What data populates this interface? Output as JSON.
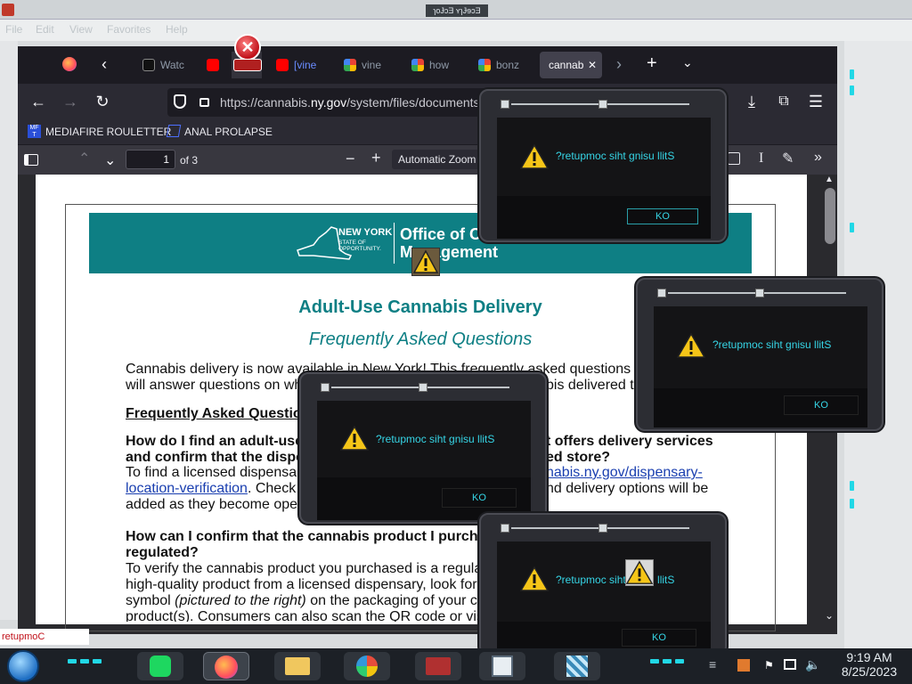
{
  "os": {
    "top_strip_title": "ɿoɈɔƎ ʏɿɈɘɔƎ",
    "menu": [
      "File",
      "Edit",
      "View",
      "Favorites",
      "Help"
    ],
    "desktop_badge": "retupmoC",
    "clock": {
      "time": "9:19 AM",
      "date": "8/25/2023"
    }
  },
  "browser": {
    "tabs": [
      {
        "label": "Watc",
        "icon": "video-site-icon"
      },
      {
        "label": "",
        "icon": "youtube-icon"
      },
      {
        "label": "",
        "icon": "youtube-icon"
      },
      {
        "label": "[vine",
        "icon": "youtube-icon"
      },
      {
        "label": "vine",
        "icon": "google-icon"
      },
      {
        "label": "how",
        "icon": "google-icon"
      },
      {
        "label": "bonz",
        "icon": "google-icon"
      },
      {
        "label": "cannab",
        "icon": "pdf-icon",
        "active": true
      }
    ],
    "url": {
      "prefix": "https://cannabis.",
      "host": "ny.gov",
      "suffix": "/system/files/documents"
    },
    "bookmarks": [
      {
        "label": "MEDIAFIRE ROULETTER",
        "icon": "mediafire-icon"
      },
      {
        "label": "ANAL PROLAPSE",
        "icon": "bookmark-icon"
      }
    ],
    "pdf": {
      "page": "1",
      "of": "of 3",
      "zoom": "Automatic Zoom"
    }
  },
  "document": {
    "banner": {
      "ny": "NEW YORK",
      "sub": "STATE OF OPPORTUNITY.",
      "office_line1": "Office of Ca",
      "office_line2": "Management"
    },
    "title": "Adult-Use Cannabis Delivery",
    "subtitle": "Frequently Asked Questions",
    "intro_1": "Cannabis delivery is now available in New York! This frequently asked questions (F",
    "intro_2": "will answer questions on wh",
    "intro_2b": "bis delivered to",
    "faq_heading": "Frequently Asked Questio",
    "q1_a": "How do I find an adult-use",
    "q1_a2": "t offers delivery services",
    "q1_b": "and confirm that the dispe",
    "q1_b2": "ed store?",
    "a1_1": "To find a licensed dispensar",
    "a1_1b": "nabis.ny.gov/dispensary-",
    "a1_2_link": "location-verification",
    "a1_2": ". Check t",
    "a1_2b": "nd delivery options will be",
    "a1_3": "added as they become oper",
    "q2_a": "How can I confirm that the cannabis product I purcha",
    "q2_b": "regulated?",
    "a2_1": "To verify the cannabis product you purchased is a regulat",
    "a2_2": "high-quality product from a licensed dispensary, look for t",
    "a2_3a": "symbol ",
    "a2_3i": "(pictured to the right)",
    "a2_3b": " on the packaging of your ca",
    "a2_4": "product(s). Consumers can also scan the QR code or visi"
  },
  "dialogs": [
    {
      "message": "?retupmoc siht gnisu llitS",
      "button": "KO"
    },
    {
      "message": "?retupmoc siht gnisu llitS",
      "button": "KO"
    },
    {
      "message": "?retupmoc siht gnisu llitS",
      "button": "KO"
    },
    {
      "message": "?retupmoc siht gnisu llitS",
      "button": "KO"
    }
  ],
  "colors": {
    "dialog_text": "#36d5e6",
    "banner": "#0e7f84",
    "browser_dark": "#1c1b22"
  }
}
